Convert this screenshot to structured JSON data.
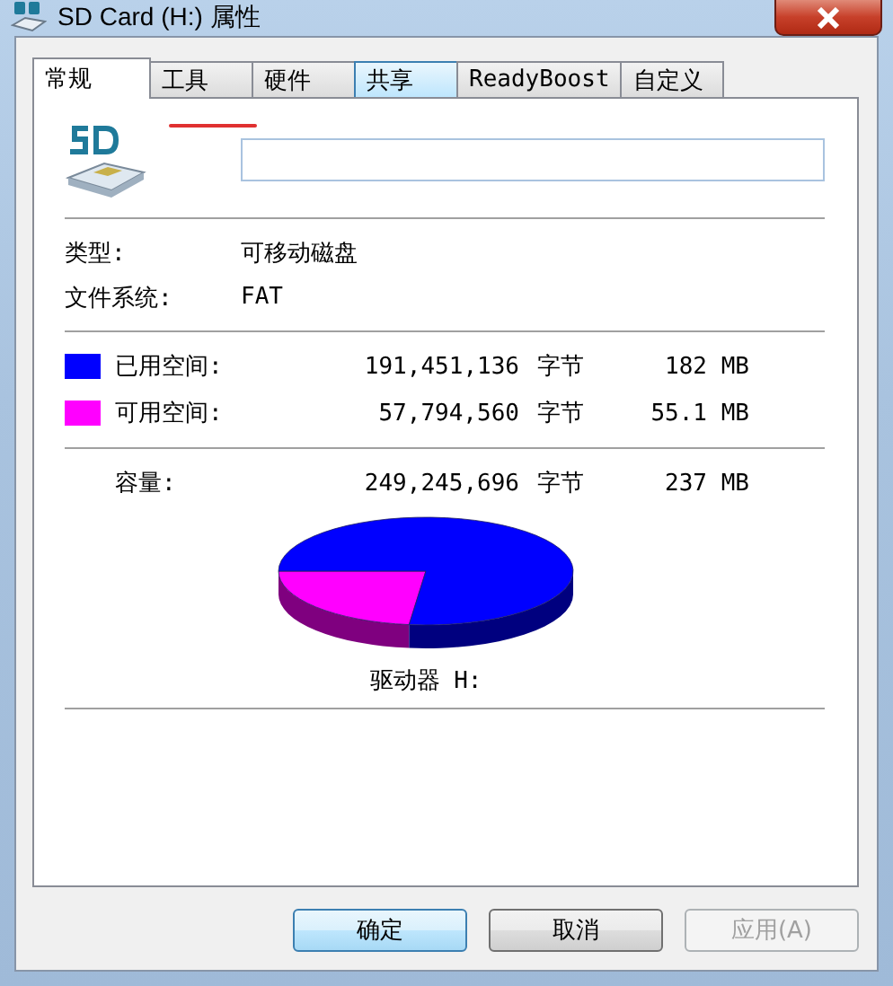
{
  "window": {
    "title": "SD Card (H:) 属性"
  },
  "tabs": [
    {
      "label": "常规",
      "selected": true,
      "hovered": false
    },
    {
      "label": "工具",
      "selected": false,
      "hovered": false
    },
    {
      "label": "硬件",
      "selected": false,
      "hovered": false
    },
    {
      "label": "共享",
      "selected": false,
      "hovered": true
    },
    {
      "label": "ReadyBoost",
      "selected": false,
      "hovered": false
    },
    {
      "label": "自定义",
      "selected": false,
      "hovered": false
    }
  ],
  "info": [
    {
      "label": "类型:",
      "value": "可移动磁盘"
    },
    {
      "label": "文件系统:",
      "value": "FAT"
    }
  ],
  "usage": [
    {
      "label": "已用空间:",
      "bytes": "191,451,136",
      "unit": "字节",
      "size": "182 MB",
      "color": "#0000ff"
    },
    {
      "label": "可用空间:",
      "bytes": "57,794,560",
      "unit": "字节",
      "size": "55.1 MB",
      "color": "#ff00ff"
    }
  ],
  "capacity": {
    "label": "容量:",
    "bytes": "249,245,696",
    "unit": "字节",
    "size": "237 MB"
  },
  "drive": {
    "label": "驱动器 H:"
  },
  "buttons": [
    {
      "label": "确定",
      "kind": "default",
      "disabled": false
    },
    {
      "label": "取消",
      "kind": "normal",
      "disabled": false
    },
    {
      "label": "应用(A)",
      "kind": "normal",
      "disabled": true
    }
  ]
}
